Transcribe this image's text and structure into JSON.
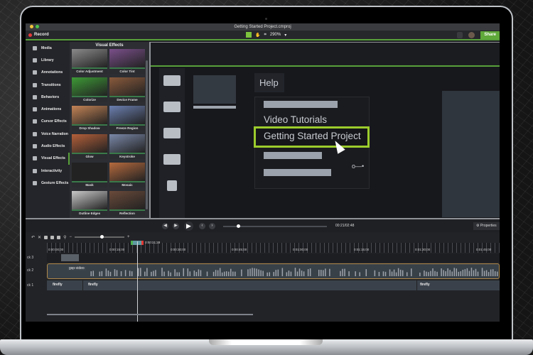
{
  "window": {
    "title": "Getting Started Project.cmproj",
    "traffic_colors": [
      "#f2c33b",
      "#4cc24a"
    ]
  },
  "toolbar": {
    "record_label": "Record",
    "zoom_level": "290%",
    "share_label": "Share"
  },
  "left_nav": {
    "items": [
      {
        "label": "Media"
      },
      {
        "label": "Library"
      },
      {
        "label": "Annotations"
      },
      {
        "label": "Transitions"
      },
      {
        "label": "Behaviors"
      },
      {
        "label": "Animations"
      },
      {
        "label": "Cursor Effects"
      },
      {
        "label": "Voice Narration"
      },
      {
        "label": "Audio Effects"
      },
      {
        "label": "Visual Effects",
        "active": true
      },
      {
        "label": "Interactivity"
      },
      {
        "label": "Gesture Effects"
      }
    ]
  },
  "effects_panel": {
    "title": "Visual Effects",
    "tiles": [
      {
        "label": "Color Adjustment",
        "color": "#8a8a8a"
      },
      {
        "label": "Color Tint",
        "color": "#7a4f8a"
      },
      {
        "label": "Colorize",
        "color": "#3d9a36"
      },
      {
        "label": "Device Frame",
        "color": "#8a5a3c"
      },
      {
        "label": "Drop Shadow",
        "color": "#c48456"
      },
      {
        "label": "Freeze Region",
        "color": "#6b7fb0"
      },
      {
        "label": "Glow",
        "color": "#b5603a"
      },
      {
        "label": "Keystroke",
        "color": "#7a88a8"
      },
      {
        "label": "Mask",
        "color": "#222222"
      },
      {
        "label": "Mosaic",
        "color": "#b66a3e"
      },
      {
        "label": "Outline Edges",
        "color": "#c8c8c8"
      },
      {
        "label": "Reflection",
        "color": "#6a4a3a"
      },
      {
        "label": "",
        "color": "#3c3a38"
      },
      {
        "label": "",
        "color": "#a8783a"
      }
    ]
  },
  "help_menu": {
    "tab_label": "Help",
    "items": [
      {
        "label": "Video Tutorials"
      },
      {
        "label": "Getting Started Project",
        "highlighted": true
      }
    ],
    "accent_color": "#9ccc2c"
  },
  "playback": {
    "timecode": "00:21/02:48",
    "progress": 0.13,
    "properties_label": "Properties"
  },
  "timeline": {
    "playhead_time": "0:00:21;28",
    "ruler_labels": [
      "0:00:00;00",
      "0:00:15;00",
      "0:00:30;00",
      "0:00:45;00",
      "0:01:00;00",
      "0:01:15;00",
      "0:01:30;00",
      "0:01:45;00"
    ],
    "tracks": [
      {
        "label": "ck 3",
        "clips": []
      },
      {
        "label": "ck 2",
        "clips": [
          {
            "name": "gsp-video"
          }
        ]
      },
      {
        "label": "ck 1",
        "clips": [
          {
            "name": "firefly"
          },
          {
            "name": "firefly"
          },
          {
            "name": "firefly"
          }
        ]
      }
    ]
  }
}
